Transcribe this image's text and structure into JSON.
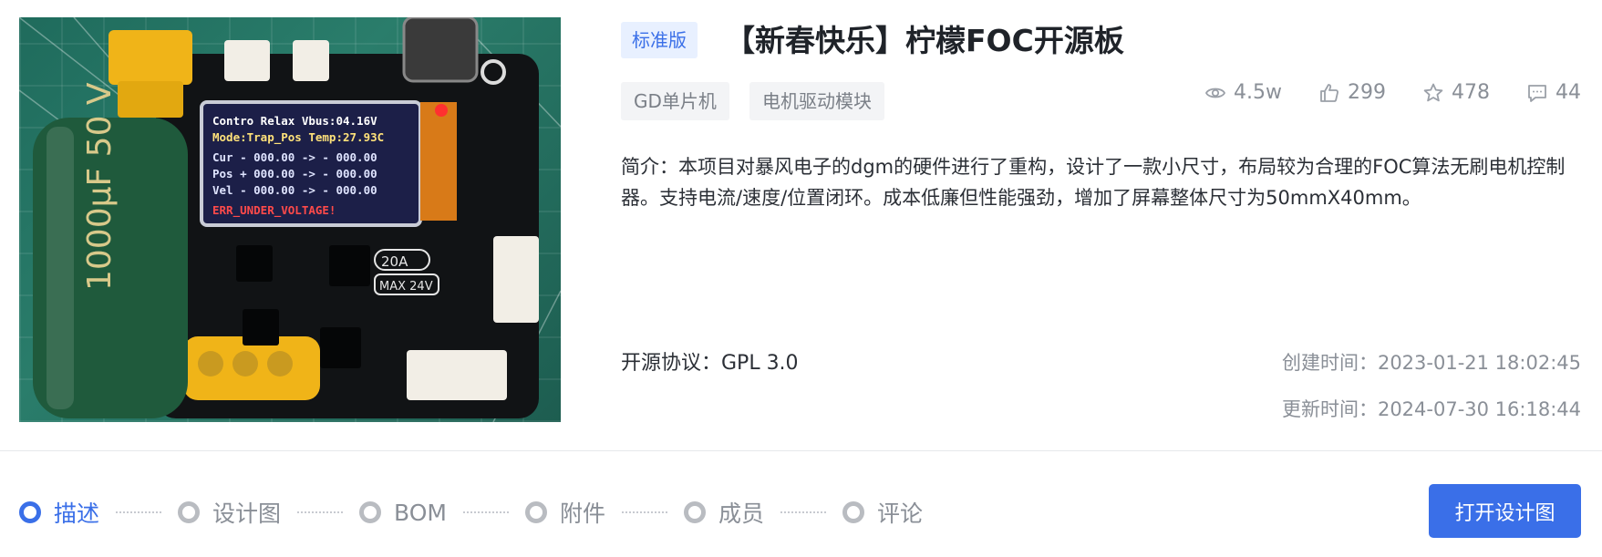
{
  "photo": {
    "alt_icon": "product-photo"
  },
  "header": {
    "edition_badge": "标准版",
    "title": "【新春快乐】柠檬FOC开源板",
    "tags": [
      "GD单片机",
      "电机驱动模块"
    ]
  },
  "stats": {
    "views": "4.5w",
    "likes": "299",
    "stars": "478",
    "comments": "44",
    "icons": [
      "eye-icon",
      "thumbs-up-icon",
      "star-icon",
      "comment-icon"
    ]
  },
  "intro": "简介：本项目对暴风电子的dgm的硬件进行了重构，设计了一款小尺寸，布局较为合理的FOC算法无刷电机控制器。支持电流/速度/位置闭环。成本低廉但性能强劲，增加了屏幕整体尺寸为50mmX40mm。",
  "license": "开源协议：GPL 3.0",
  "times": {
    "created": "创建时间：2023-01-21 18:02:45",
    "updated": "更新时间：2024-07-30 16:18:44"
  },
  "tabs": [
    {
      "label": "描述",
      "active": true
    },
    {
      "label": "设计图",
      "active": false
    },
    {
      "label": "BOM",
      "active": false
    },
    {
      "label": "附件",
      "active": false
    },
    {
      "label": "成员",
      "active": false
    },
    {
      "label": "评论",
      "active": false
    }
  ],
  "open_button": "打开设计图",
  "colors": {
    "accent": "#3a6fe8",
    "muted": "#8a8f97",
    "badge_bg": "#e8f0ff",
    "tag_bg": "#f3f4f6"
  },
  "board_screen": {
    "lines": [
      "Contro Relax Vbus:04.16V",
      "Mode:Trap_Pos Temp:27.93C",
      "Cur - 000.00 -> - 000.00",
      "Pos + 000.00 -> - 000.00",
      "Vel - 000.00 -> - 000.00",
      "ERR_UNDER_VOLTAGE!"
    ],
    "capacitor_text": "1000μF 50 V",
    "rating": "20A",
    "max_voltage": "MAX 24V"
  }
}
